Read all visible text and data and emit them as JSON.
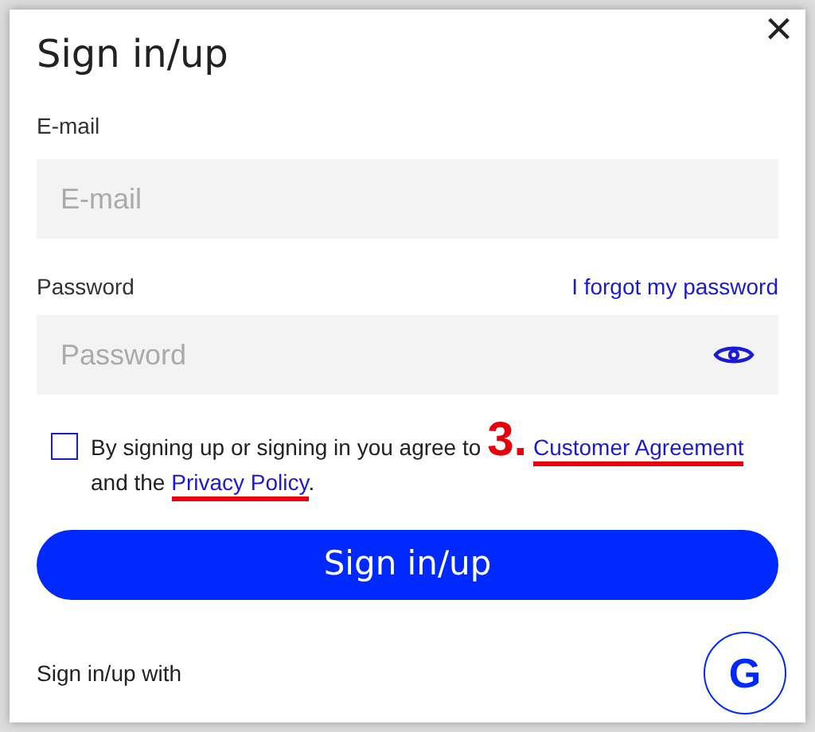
{
  "dialog": {
    "title": "Sign in/up",
    "close": "×"
  },
  "email": {
    "label": "E-mail",
    "placeholder": "E-mail"
  },
  "password": {
    "label": "Password",
    "forgot_link": "I forgot my password",
    "placeholder": "Password",
    "masked": true
  },
  "consent": {
    "checked": false,
    "text_before": "By signing up or signing in you agree to",
    "annotation": "3.",
    "link_1": {
      "text": "Customer Agreement",
      "annotated": true
    },
    "text_middle": "and the",
    "link_2": {
      "text": "Privacy Policy",
      "annotated": true
    },
    "text_after": "."
  },
  "submit": "Sign in/up",
  "social": {
    "label": "Sign in/up with",
    "provider": "G"
  }
}
